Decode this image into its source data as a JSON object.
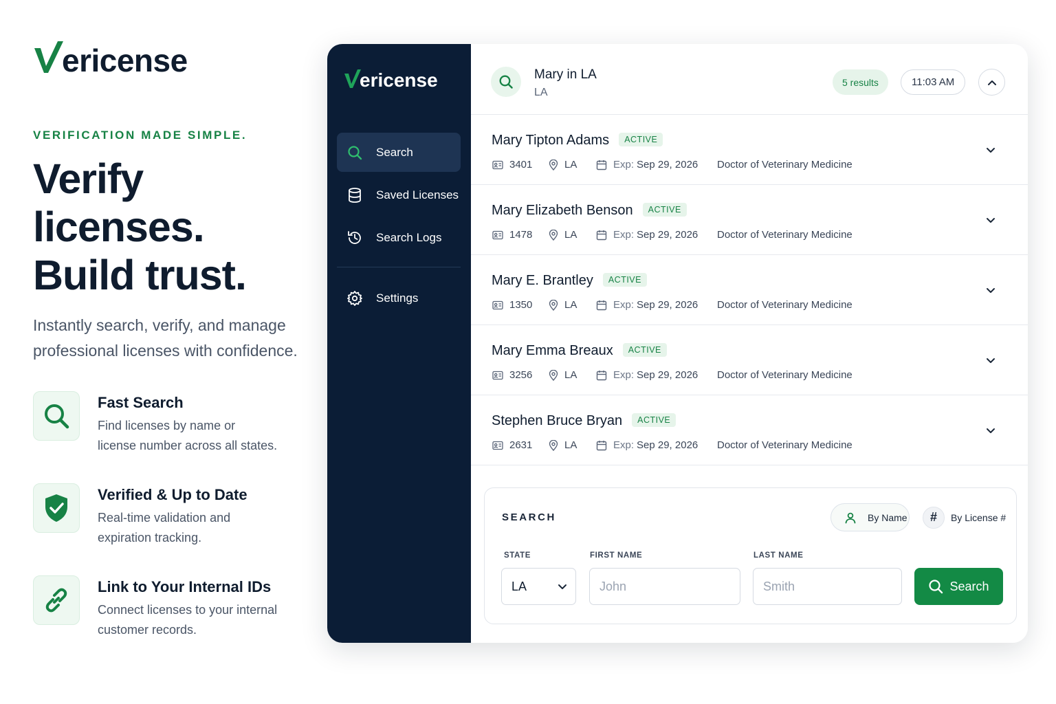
{
  "brand": {
    "name": "ericense",
    "accent": "#178245",
    "navy": "#0b1d36"
  },
  "hero": {
    "tagline": "VERIFICATION MADE SIMPLE.",
    "headline_line1": "Verify licenses.",
    "headline_line2": "Build trust.",
    "lead_line1": "Instantly search, verify, and manage",
    "lead_line2": "professional licenses with confidence.",
    "features": [
      {
        "icon": "search-icon",
        "title": "Fast Search",
        "desc": "Find licenses by name or\nlicense number across all states."
      },
      {
        "icon": "shield-check-icon",
        "title": "Verified & Up to Date",
        "desc": "Real-time validation and\nexpiration tracking."
      },
      {
        "icon": "link-icon",
        "title": "Link to Your Internal IDs",
        "desc": "Connect licenses to your internal\ncustomer records."
      }
    ]
  },
  "sidebar": {
    "items": [
      {
        "icon": "search-icon",
        "label": "Search",
        "active": true
      },
      {
        "icon": "database-icon",
        "label": "Saved Licenses"
      },
      {
        "icon": "history-icon",
        "label": "Search Logs"
      },
      {
        "icon": "gear-icon",
        "label": "Settings"
      }
    ]
  },
  "results_header": {
    "query": "Mary in LA",
    "query_sub": "LA",
    "results_count": "5 results",
    "time": "11:03 AM"
  },
  "results": [
    {
      "name": "Mary Tipton Adams",
      "status": "ACTIVE",
      "license": "3401",
      "state": "LA",
      "exp_label": "Exp:",
      "exp": "Sep 29, 2026",
      "profession": "Doctor of Veterinary Medicine"
    },
    {
      "name": "Mary Elizabeth Benson",
      "status": "ACTIVE",
      "license": "1478",
      "state": "LA",
      "exp_label": "Exp:",
      "exp": "Sep 29, 2026",
      "profession": "Doctor of Veterinary Medicine"
    },
    {
      "name": "Mary E. Brantley",
      "status": "ACTIVE",
      "license": "1350",
      "state": "LA",
      "exp_label": "Exp:",
      "exp": "Sep 29, 2026",
      "profession": "Doctor of Veterinary Medicine"
    },
    {
      "name": "Mary Emma Breaux",
      "status": "ACTIVE",
      "license": "3256",
      "state": "LA",
      "exp_label": "Exp:",
      "exp": "Sep 29, 2026",
      "profession": "Doctor of Veterinary Medicine"
    },
    {
      "name": "Stephen Bruce Bryan",
      "status": "ACTIVE",
      "license": "2631",
      "state": "LA",
      "exp_label": "Exp:",
      "exp": "Sep 29, 2026",
      "profession": "Doctor of Veterinary Medicine"
    }
  ],
  "search_form": {
    "title": "SEARCH",
    "mode_name": "By Name",
    "mode_license": "By License #",
    "mode_license_glyph": "#",
    "state_label": "STATE",
    "state_value": "LA",
    "first_name_label": "FIRST NAME",
    "first_name_placeholder": "John",
    "last_name_label": "LAST NAME",
    "last_name_placeholder": "Smith",
    "submit": "Search"
  }
}
